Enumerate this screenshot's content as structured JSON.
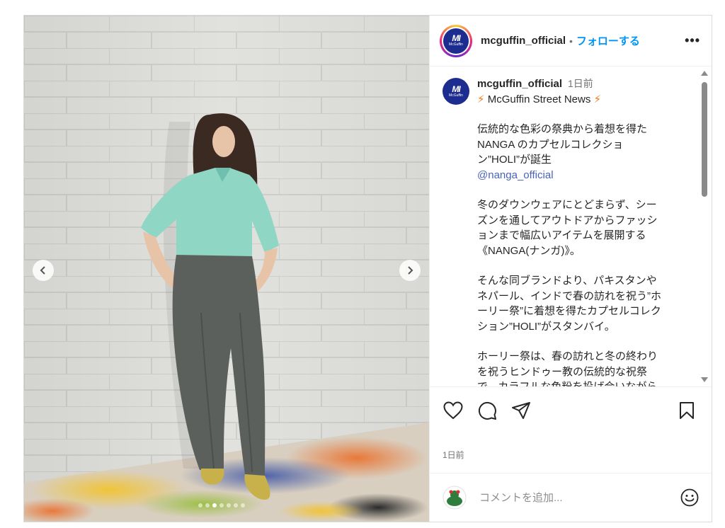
{
  "post": {
    "username": "mcguffin_official",
    "separator": "•",
    "follow_label": "フォローする",
    "more_label": "•••",
    "logo_mark": "MI",
    "logo_text": "McGuffin"
  },
  "media": {
    "slide_count": 7,
    "active_slide": 3,
    "prev_label": "‹",
    "next_label": "›"
  },
  "caption": {
    "username": "mcguffin_official",
    "time": "1日前",
    "headline_bolt": "⚡",
    "headline": "McGuffin Street News",
    "para1_line1": "伝統的な色彩の祭典から着想を得た",
    "para1_line2": "NANGA のカプセルコレクショ",
    "para1_line3": "ン”HOLI”が誕生",
    "mention": "@nanga_official",
    "para2": "冬のダウンウェアにとどまらず、シー\nズンを通してアウトドアからファッシ\nョンまで幅広いアイテムを展開する\n《NANGA(ナンガ)》。",
    "para3": "そんな同ブランドより、パキスタンや\nネパール、インドで春の訪れを祝う”ホ\nーリー祭”に着想を得たカプセルコレク\nション”HOLI”がスタンバイ。",
    "para4": "ホーリー祭は、春の訪れと冬の終わり\nを祝うヒンドゥー教の伝統的な祝祭\nで、カラフルな色粉を投げ合いながら"
  },
  "footer": {
    "date": "1日前",
    "comment_placeholder": "コメントを追加..."
  },
  "icons": {
    "like": "heart-icon",
    "comment": "comment-icon",
    "share": "send-icon",
    "save": "bookmark-icon",
    "emoji": "smile-icon"
  },
  "colors": {
    "follow": "#0095f6",
    "brand": "#1d2c8f",
    "mention": "#4763b8",
    "bolt": "#f7771c"
  }
}
